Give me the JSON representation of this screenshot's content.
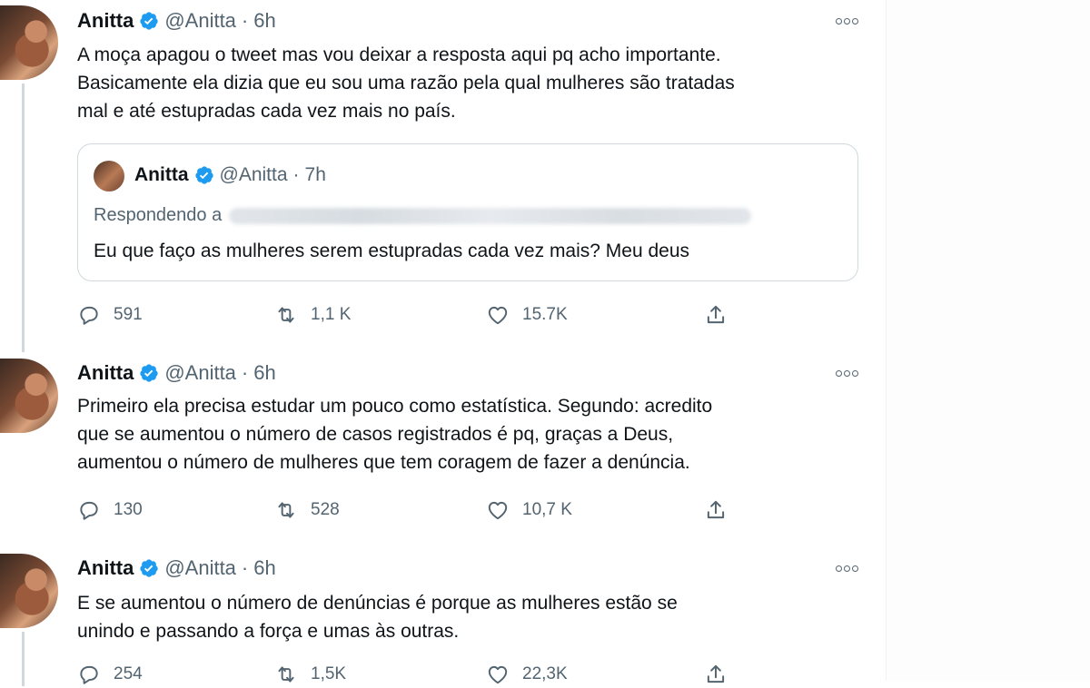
{
  "tweets": [
    {
      "name": "Anitta",
      "handle": "@Anitta",
      "time": "6h",
      "text_lines": [
        "A moça apagou o tweet mas vou deixar a resposta aqui pq acho importante.",
        "Basicamente ela dizia que eu sou uma razão pela qual mulheres são tratadas",
        "mal e até estupradas cada vez mais no país."
      ],
      "quote": {
        "name": "Anitta",
        "handle": "@Anitta",
        "time": "7h",
        "replying_to": "Respondendo a",
        "text": "Eu que faço as mulheres serem estupradas cada vez mais? Meu deus"
      },
      "replies": "591",
      "retweets": "1,1 K",
      "likes": "15.7K"
    },
    {
      "name": "Anitta",
      "handle": "@Anitta",
      "time": "6h",
      "text_lines": [
        "Primeiro ela precisa estudar um pouco como estatística. Segundo: acredito",
        "que se aumentou o número de casos registrados é pq, graças a Deus,",
        "aumentou o número de mulheres que tem coragem de fazer a denúncia."
      ],
      "replies": "130",
      "retweets": "528",
      "likes": "10,7 K"
    },
    {
      "name": "Anitta",
      "handle": "@Anitta",
      "time": "6h",
      "text_lines": [
        "E se aumentou o número de denúncias é porque as mulheres estão se",
        "unindo e passando a força e umas às outras."
      ],
      "replies": "254",
      "retweets": "1,5K",
      "likes": "22,3K"
    }
  ],
  "icons": {
    "verified": "verified-badge-icon",
    "reply": "reply-icon",
    "retweet": "retweet-icon",
    "like": "heart-icon",
    "share": "share-icon",
    "more": "more-options-icon"
  },
  "colors": {
    "verified_blue": "#1d9bf0",
    "secondary_text": "#536471",
    "thread_line": "#cfd9de"
  }
}
